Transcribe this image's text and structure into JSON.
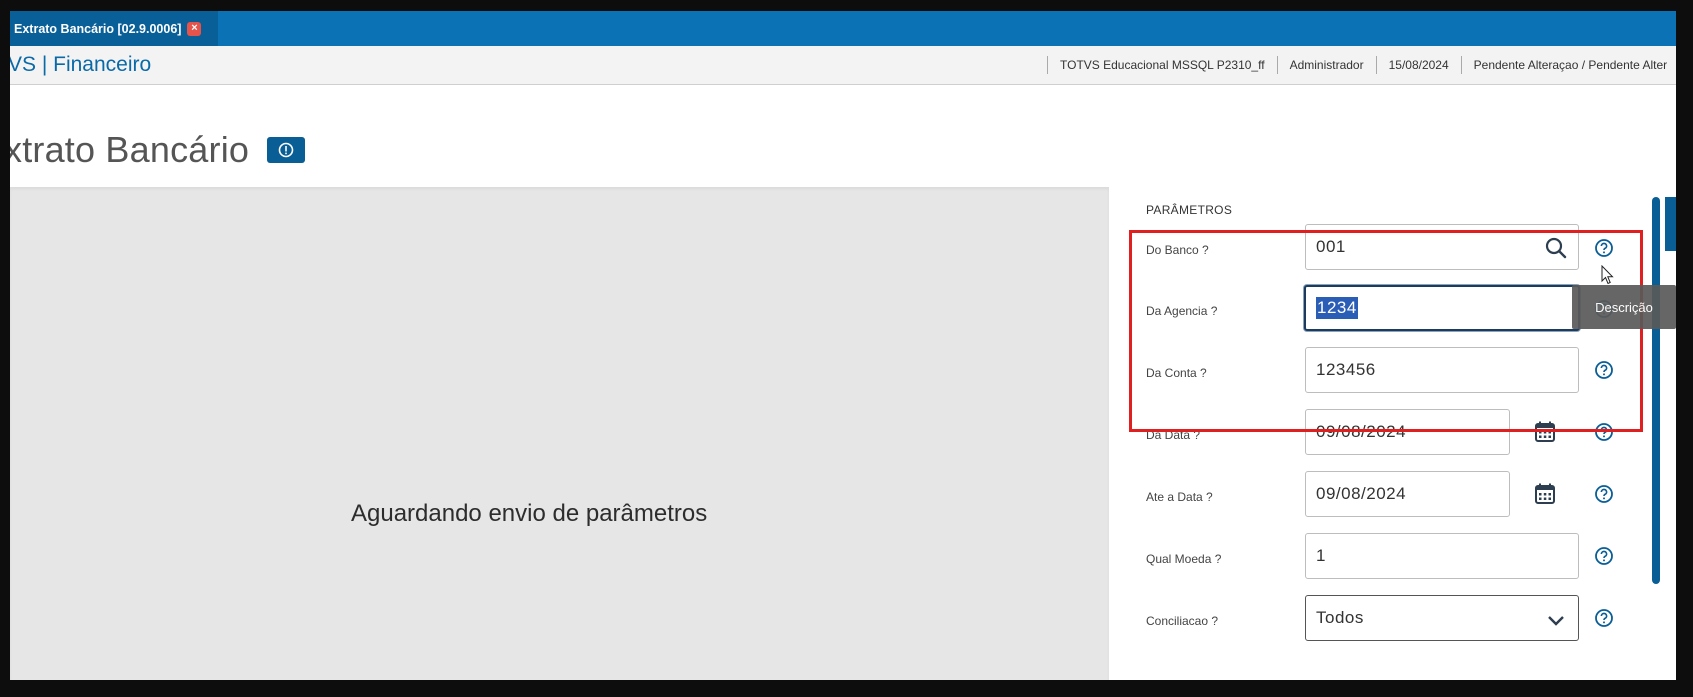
{
  "tab": {
    "label": "Extrato Bancário [02.9.0006]"
  },
  "header": {
    "brand": "VS | Financeiro",
    "status": [
      "TOTVS Educacional MSSQL P2310_ff",
      "Administrador",
      "15/08/2024",
      "Pendente Alteraçao / Pendente Alter"
    ]
  },
  "page": {
    "title": "xtrato Bancário"
  },
  "main": {
    "message": "Aguardando envio de parâmetros"
  },
  "params": {
    "heading": "PARÂMETROS",
    "fields": [
      {
        "label": "Do Banco ?",
        "value": "001"
      },
      {
        "label": "Da Agencia ?",
        "value": "1234"
      },
      {
        "label": "Da Conta ?",
        "value": "123456"
      },
      {
        "label": "Da Data ?",
        "value": "09/08/2024"
      },
      {
        "label": "Ate a Data ?",
        "value": "09/08/2024"
      },
      {
        "label": "Qual Moeda ?",
        "value": "1"
      },
      {
        "label": "Conciliacao ?",
        "value": "Todos"
      }
    ]
  },
  "tooltip": "Descrição",
  "colors": {
    "accent": "#0b72b5",
    "highlight": "#e02020",
    "selection": "#2a5db5"
  }
}
